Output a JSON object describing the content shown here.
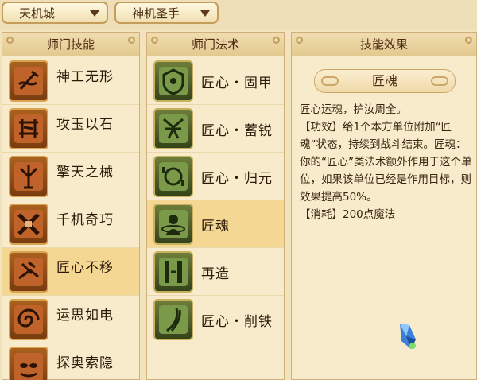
{
  "topbar": {
    "dropdown1": {
      "value": "天机城"
    },
    "dropdown2": {
      "value": "神机圣手"
    }
  },
  "skills_panel": {
    "header": "师门技能",
    "items": [
      {
        "label": "神工无形",
        "icon": "craft-hammer-icon",
        "selected": false
      },
      {
        "label": "攻玉以石",
        "icon": "stone-gear-icon",
        "selected": false
      },
      {
        "label": "擎天之械",
        "icon": "pillar-icon",
        "selected": false
      },
      {
        "label": "千机奇巧",
        "icon": "cross-tools-icon",
        "selected": false
      },
      {
        "label": "匠心不移",
        "icon": "anvil-icon",
        "selected": true
      },
      {
        "label": "运思如电",
        "icon": "swirl-icon",
        "selected": false
      },
      {
        "label": "探奥索隐",
        "icon": "mask-icon",
        "selected": false
      }
    ]
  },
  "spells_panel": {
    "header": "师门法术",
    "items": [
      {
        "label": "匠心・固甲",
        "icon": "shield-emblem-icon",
        "selected": false
      },
      {
        "label": "匠心・蓄锐",
        "icon": "mech-figure-icon",
        "selected": false
      },
      {
        "label": "匠心・归元",
        "icon": "return-circle-icon",
        "selected": false
      },
      {
        "label": "匠魂",
        "icon": "soul-figure-icon",
        "selected": true
      },
      {
        "label": "再造",
        "icon": "rebuild-bars-icon",
        "selected": false
      },
      {
        "label": "匠心・削铁",
        "icon": "blade-icon",
        "selected": false
      }
    ]
  },
  "effect_panel": {
    "header": "技能效果",
    "title": "匠魂",
    "lines": [
      "匠心运魂，护汝周全。",
      "【功效】给1个本方单位附加“匠魂”状态，持续到战斗结束。匠魂：你的“匠心”类法术额外作用于这个单位，如果该单位已经是作用目标，则效果提高50%。",
      "【消耗】200点魔法"
    ]
  },
  "colors": {
    "background": "#f2e3bd",
    "selected_row": "#f4d793",
    "red_icon": "#8a4514",
    "green_icon": "#4a5a24"
  }
}
